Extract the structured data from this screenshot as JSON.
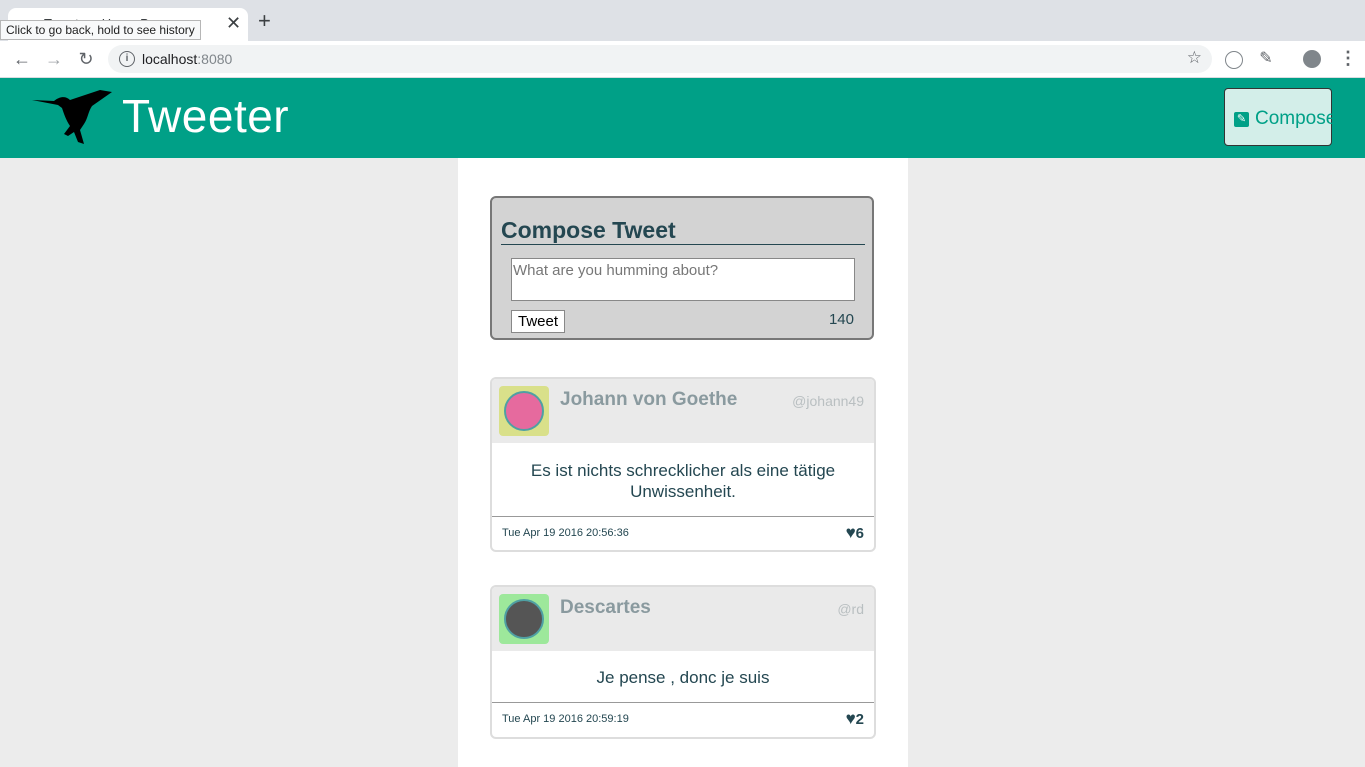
{
  "browser": {
    "tab_title": "Tweeter - Home Page",
    "tooltip": "Click to go back, hold to see history",
    "url_host": "localhost",
    "url_port": ":8080",
    "icons": {
      "back": "arrow-left-icon",
      "forward": "arrow-right-icon",
      "reload": "reload-icon",
      "info": "info-icon",
      "star": "star-icon",
      "menu": "vertical-dots-icon"
    }
  },
  "header": {
    "brand": "Tweeter",
    "compose_label": "Compose",
    "color": "#00a087"
  },
  "compose": {
    "heading": "Compose Tweet",
    "placeholder": "What are you humming about?",
    "submit_label": "Tweet",
    "counter": "140"
  },
  "tweets": [
    {
      "name": "Johann von Goethe",
      "handle": "@johann49",
      "text": "Es ist nichts schrecklicher als eine tätige Unwissenheit.",
      "timestamp": "Tue Apr 19 2016 20:56:36",
      "likes": "6",
      "avatar_bg": "#d9e08a",
      "avatar_face": "#e66a9e"
    },
    {
      "name": "Descartes",
      "handle": "@rd",
      "text": "Je pense , donc je suis",
      "timestamp": "Tue Apr 19 2016 20:59:19",
      "likes": "2",
      "avatar_bg": "#9de89b",
      "avatar_face": "#555555"
    }
  ]
}
